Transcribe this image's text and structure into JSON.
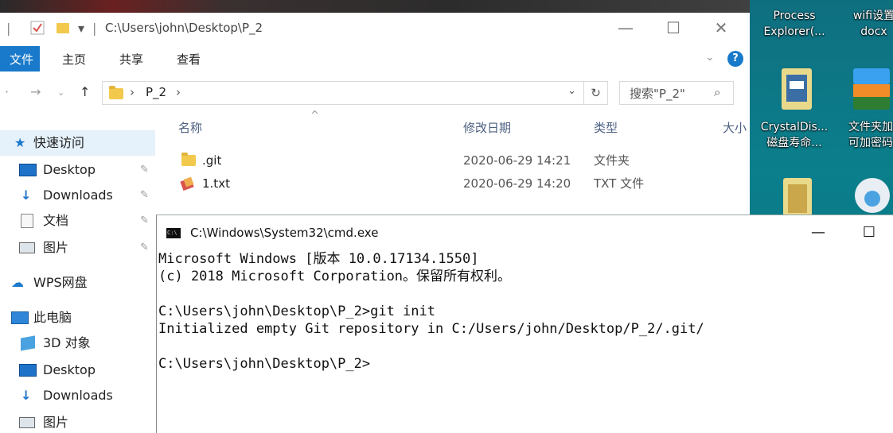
{
  "explorer": {
    "title_path": "C:\\Users\\john\\Desktop\\P_2",
    "window_controls": {
      "minimize": "—",
      "maximize": "☐",
      "close": "✕"
    },
    "ribbon_tabs": [
      "文件",
      "主页",
      "共享",
      "查看"
    ],
    "address": {
      "segment": "P_2",
      "sep": "›",
      "search_placeholder": "搜索\"P_2\""
    },
    "columns": {
      "name": "名称",
      "date": "修改日期",
      "type": "类型",
      "size": "大小"
    },
    "files": [
      {
        "name": ".git",
        "date": "2020-06-29 14:21",
        "type": "文件夹"
      },
      {
        "name": "1.txt",
        "date": "2020-06-29 14:20",
        "type": "TXT 文件"
      }
    ],
    "sidebar": {
      "quick_access": "快速访问",
      "quick_items": [
        "Desktop",
        "Downloads",
        "文档",
        "图片"
      ],
      "wps": "WPS网盘",
      "this_pc": "此电脑",
      "pc_items": [
        "3D 对象",
        "Desktop",
        "Downloads",
        "图片"
      ]
    }
  },
  "desktop": {
    "items": [
      {
        "line1": "Process",
        "line2": "Explorer(..."
      },
      {
        "line1": "wifi设置",
        "line2": "docx"
      },
      {
        "line1": "CrystalDis...",
        "line2": "磁盘寿命..."
      },
      {
        "line1": "文件夹加",
        "line2": "可加密码"
      }
    ]
  },
  "cmd": {
    "title": "C:\\Windows\\System32\\cmd.exe",
    "minimize": "—",
    "maximize": "☐",
    "lines": [
      "Microsoft Windows [版本 10.0.17134.1550]",
      "(c) 2018 Microsoft Corporation。保留所有权利。",
      "",
      "C:\\Users\\john\\Desktop\\P_2>git init",
      "Initialized empty Git repository in C:/Users/john/Desktop/P_2/.git/",
      "",
      "C:\\Users\\john\\Desktop\\P_2>"
    ]
  },
  "colors": {
    "accent": "#1979ca",
    "header_text": "#4d6082",
    "desktop_bg": "#0b7f8c"
  }
}
